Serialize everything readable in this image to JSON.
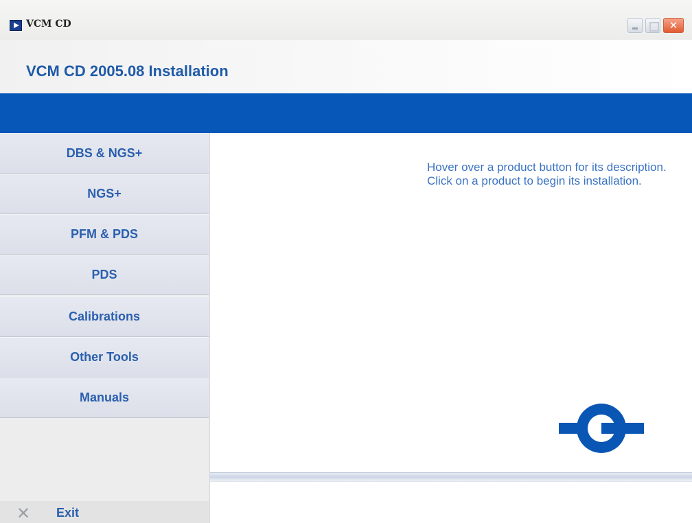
{
  "window": {
    "title": "VCM CD"
  },
  "header": {
    "title": "VCM CD 2005.08 Installation"
  },
  "sidebar": {
    "items": [
      {
        "label": "DBS & NGS+"
      },
      {
        "label": "NGS+"
      },
      {
        "label": "PFM & PDS"
      },
      {
        "label": "PDS"
      },
      {
        "label": "Calibrations"
      },
      {
        "label": "Other Tools"
      },
      {
        "label": "Manuals"
      }
    ],
    "exit_label": "Exit",
    "exit_icon": "close-x-icon"
  },
  "main": {
    "description": "Hover over a product button for its description. Click on a product to begin its installation."
  },
  "colors": {
    "brand_blue": "#0757b8",
    "text_blue": "#2a5fae",
    "logo_blue": "#0a56b4"
  }
}
